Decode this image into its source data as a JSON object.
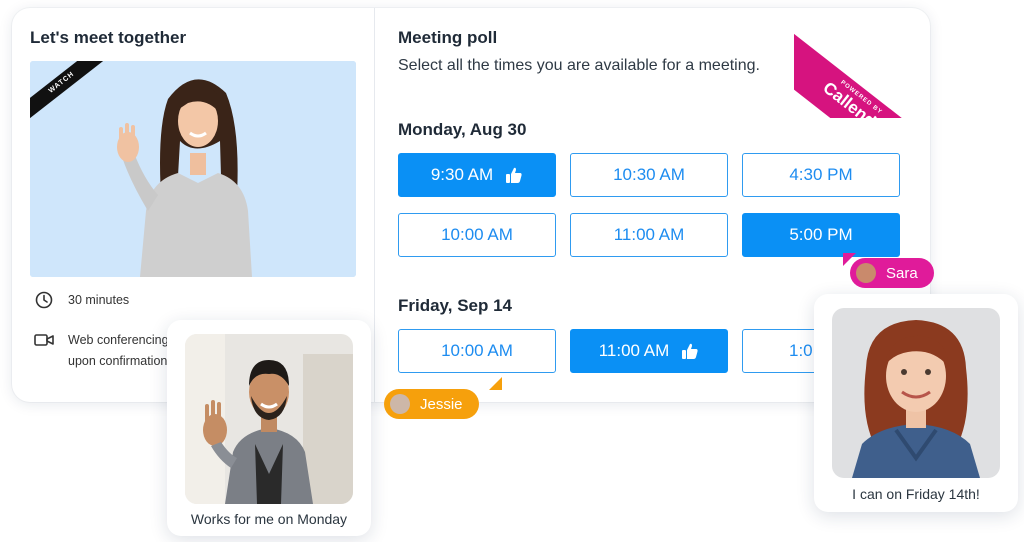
{
  "left": {
    "title": "Let's meet together",
    "video_ribbon": "WATCH",
    "duration": "30 minutes",
    "conferencing_line1": "Web conferencing",
    "conferencing_line2": "upon confirmation"
  },
  "poll": {
    "title": "Meeting poll",
    "subtitle": "Select all the times you are available for a meeting.",
    "days": [
      {
        "label": "Monday, Aug 30",
        "slots": [
          {
            "time": "9:30 AM",
            "selected": true,
            "liked": true
          },
          {
            "time": "10:30 AM",
            "selected": false,
            "liked": false
          },
          {
            "time": "4:30 PM",
            "selected": false,
            "liked": false
          },
          {
            "time": "10:00 AM",
            "selected": false,
            "liked": false
          },
          {
            "time": "11:00 AM",
            "selected": false,
            "liked": false
          },
          {
            "time": "5:00 PM",
            "selected": true,
            "liked": false
          }
        ]
      },
      {
        "label": "Friday, Sep 14",
        "slots": [
          {
            "time": "10:00 AM",
            "selected": false,
            "liked": false
          },
          {
            "time": "11:00 AM",
            "selected": true,
            "liked": true
          },
          {
            "time": "1:0",
            "selected": false,
            "liked": false
          }
        ]
      }
    ]
  },
  "badge": {
    "powered": "POWERED BY",
    "brand": "Callendo"
  },
  "participants": {
    "jessie": {
      "name": "Jessie",
      "comment": "Works for me on Monday",
      "color": "#f6a00c"
    },
    "sara": {
      "name": "Sara",
      "comment": "I can on Friday 14th!",
      "color": "#e01b9a"
    }
  },
  "colors": {
    "accent": "#0a90f5",
    "brand": "#d6137f"
  }
}
